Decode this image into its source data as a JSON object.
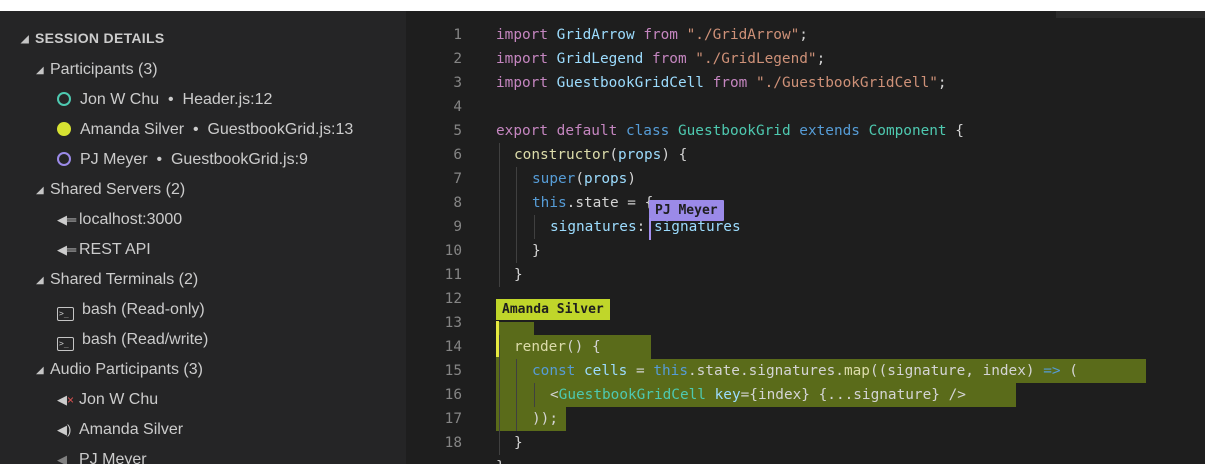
{
  "sidebar": {
    "header": "SESSION DETAILS",
    "participants": {
      "label": "Participants (3)",
      "items": [
        {
          "name": "Jon W Chu",
          "file": "Header.js:12",
          "color": "#4ec9b0",
          "filled": false
        },
        {
          "name": "Amanda Silver",
          "file": "GuestbookGrid.js:13",
          "color": "#d7e232",
          "filled": true
        },
        {
          "name": "PJ Meyer",
          "file": "GuestbookGrid.js:9",
          "color": "#9b8ae8",
          "filled": false
        }
      ]
    },
    "servers": {
      "label": "Shared Servers (2)",
      "items": [
        "localhost:3000",
        "REST API"
      ]
    },
    "terminals": {
      "label": "Shared Terminals (2)",
      "items": [
        "bash (Read-only)",
        "bash (Read/write)"
      ]
    },
    "audio": {
      "label": "Audio Participants (3)",
      "items": [
        "Jon W Chu",
        "Amanda Silver",
        "PJ Meyer"
      ]
    }
  },
  "editor": {
    "line_numbers": [
      "1",
      "2",
      "3",
      "4",
      "5",
      "6",
      "7",
      "8",
      "9",
      "10",
      "11",
      "12",
      "13",
      "14",
      "15",
      "16",
      "17",
      "18"
    ],
    "code": {
      "l1": {
        "kw": "import",
        "name": "GridArrow",
        "from": "from",
        "path": "\"./GridArrow\"",
        "end": ";"
      },
      "l2": {
        "kw": "import",
        "name": "GridLegend",
        "from": "from",
        "path": "\"./GridLegend\"",
        "end": ";"
      },
      "l3": {
        "kw": "import",
        "name": "GuestbookGridCell",
        "from": "from",
        "path": "\"./GuestbookGridCell\"",
        "end": ";"
      },
      "l5": {
        "export": "export",
        "default": "default",
        "class": "class",
        "name": "GuestbookGrid",
        "extends": "extends",
        "base": "Component",
        "brace": "{"
      },
      "l6": {
        "fn": "constructor",
        "open": "(",
        "arg": "props",
        "close": ") {"
      },
      "l7": {
        "fn": "super",
        "open": "(",
        "arg": "props",
        "close": ")"
      },
      "l8": {
        "this": "this",
        "rest": ".state =",
        "tail": " {"
      },
      "l9": {
        "key": "signatures",
        "colon": ": ",
        "val": "signatures"
      },
      "l10": "}",
      "l11": "}",
      "l13": {
        "fn": "render",
        "rest": "() {"
      },
      "l14": {
        "const": "const",
        "name": "cells",
        "eq": " = ",
        "this": "this",
        "chain": ".state.signatures.",
        "map": "map",
        "args": "((signature, index) ",
        "arrow": "=>",
        "paren": " ("
      },
      "l15": {
        "open": "<",
        "tag": "GuestbookGridCell",
        "attr": "key",
        "val": "={index} {...signature}",
        "close": " />"
      },
      "l16": "));",
      "l17": "}",
      "l18": "}"
    },
    "cursor_labels": {
      "pj": "PJ Meyer",
      "amanda": "Amanda Silver"
    }
  }
}
